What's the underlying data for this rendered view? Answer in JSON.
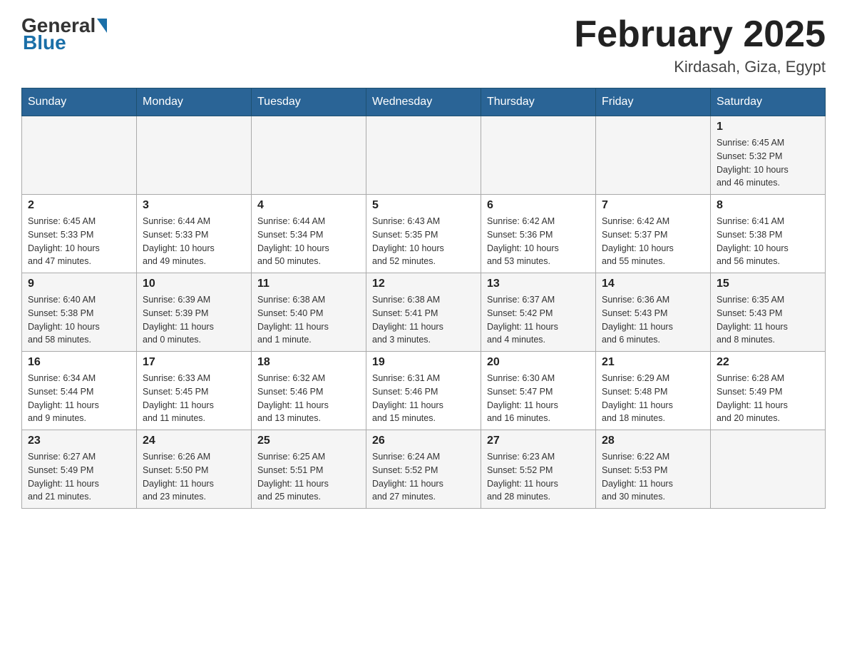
{
  "header": {
    "logo": {
      "general": "General",
      "blue": "Blue"
    },
    "title": "February 2025",
    "location": "Kirdasah, Giza, Egypt"
  },
  "calendar": {
    "weekdays": [
      "Sunday",
      "Monday",
      "Tuesday",
      "Wednesday",
      "Thursday",
      "Friday",
      "Saturday"
    ],
    "weeks": [
      [
        {
          "day": "",
          "info": ""
        },
        {
          "day": "",
          "info": ""
        },
        {
          "day": "",
          "info": ""
        },
        {
          "day": "",
          "info": ""
        },
        {
          "day": "",
          "info": ""
        },
        {
          "day": "",
          "info": ""
        },
        {
          "day": "1",
          "info": "Sunrise: 6:45 AM\nSunset: 5:32 PM\nDaylight: 10 hours\nand 46 minutes."
        }
      ],
      [
        {
          "day": "2",
          "info": "Sunrise: 6:45 AM\nSunset: 5:33 PM\nDaylight: 10 hours\nand 47 minutes."
        },
        {
          "day": "3",
          "info": "Sunrise: 6:44 AM\nSunset: 5:33 PM\nDaylight: 10 hours\nand 49 minutes."
        },
        {
          "day": "4",
          "info": "Sunrise: 6:44 AM\nSunset: 5:34 PM\nDaylight: 10 hours\nand 50 minutes."
        },
        {
          "day": "5",
          "info": "Sunrise: 6:43 AM\nSunset: 5:35 PM\nDaylight: 10 hours\nand 52 minutes."
        },
        {
          "day": "6",
          "info": "Sunrise: 6:42 AM\nSunset: 5:36 PM\nDaylight: 10 hours\nand 53 minutes."
        },
        {
          "day": "7",
          "info": "Sunrise: 6:42 AM\nSunset: 5:37 PM\nDaylight: 10 hours\nand 55 minutes."
        },
        {
          "day": "8",
          "info": "Sunrise: 6:41 AM\nSunset: 5:38 PM\nDaylight: 10 hours\nand 56 minutes."
        }
      ],
      [
        {
          "day": "9",
          "info": "Sunrise: 6:40 AM\nSunset: 5:38 PM\nDaylight: 10 hours\nand 58 minutes."
        },
        {
          "day": "10",
          "info": "Sunrise: 6:39 AM\nSunset: 5:39 PM\nDaylight: 11 hours\nand 0 minutes."
        },
        {
          "day": "11",
          "info": "Sunrise: 6:38 AM\nSunset: 5:40 PM\nDaylight: 11 hours\nand 1 minute."
        },
        {
          "day": "12",
          "info": "Sunrise: 6:38 AM\nSunset: 5:41 PM\nDaylight: 11 hours\nand 3 minutes."
        },
        {
          "day": "13",
          "info": "Sunrise: 6:37 AM\nSunset: 5:42 PM\nDaylight: 11 hours\nand 4 minutes."
        },
        {
          "day": "14",
          "info": "Sunrise: 6:36 AM\nSunset: 5:43 PM\nDaylight: 11 hours\nand 6 minutes."
        },
        {
          "day": "15",
          "info": "Sunrise: 6:35 AM\nSunset: 5:43 PM\nDaylight: 11 hours\nand 8 minutes."
        }
      ],
      [
        {
          "day": "16",
          "info": "Sunrise: 6:34 AM\nSunset: 5:44 PM\nDaylight: 11 hours\nand 9 minutes."
        },
        {
          "day": "17",
          "info": "Sunrise: 6:33 AM\nSunset: 5:45 PM\nDaylight: 11 hours\nand 11 minutes."
        },
        {
          "day": "18",
          "info": "Sunrise: 6:32 AM\nSunset: 5:46 PM\nDaylight: 11 hours\nand 13 minutes."
        },
        {
          "day": "19",
          "info": "Sunrise: 6:31 AM\nSunset: 5:46 PM\nDaylight: 11 hours\nand 15 minutes."
        },
        {
          "day": "20",
          "info": "Sunrise: 6:30 AM\nSunset: 5:47 PM\nDaylight: 11 hours\nand 16 minutes."
        },
        {
          "day": "21",
          "info": "Sunrise: 6:29 AM\nSunset: 5:48 PM\nDaylight: 11 hours\nand 18 minutes."
        },
        {
          "day": "22",
          "info": "Sunrise: 6:28 AM\nSunset: 5:49 PM\nDaylight: 11 hours\nand 20 minutes."
        }
      ],
      [
        {
          "day": "23",
          "info": "Sunrise: 6:27 AM\nSunset: 5:49 PM\nDaylight: 11 hours\nand 21 minutes."
        },
        {
          "day": "24",
          "info": "Sunrise: 6:26 AM\nSunset: 5:50 PM\nDaylight: 11 hours\nand 23 minutes."
        },
        {
          "day": "25",
          "info": "Sunrise: 6:25 AM\nSunset: 5:51 PM\nDaylight: 11 hours\nand 25 minutes."
        },
        {
          "day": "26",
          "info": "Sunrise: 6:24 AM\nSunset: 5:52 PM\nDaylight: 11 hours\nand 27 minutes."
        },
        {
          "day": "27",
          "info": "Sunrise: 6:23 AM\nSunset: 5:52 PM\nDaylight: 11 hours\nand 28 minutes."
        },
        {
          "day": "28",
          "info": "Sunrise: 6:22 AM\nSunset: 5:53 PM\nDaylight: 11 hours\nand 30 minutes."
        },
        {
          "day": "",
          "info": ""
        }
      ]
    ]
  }
}
